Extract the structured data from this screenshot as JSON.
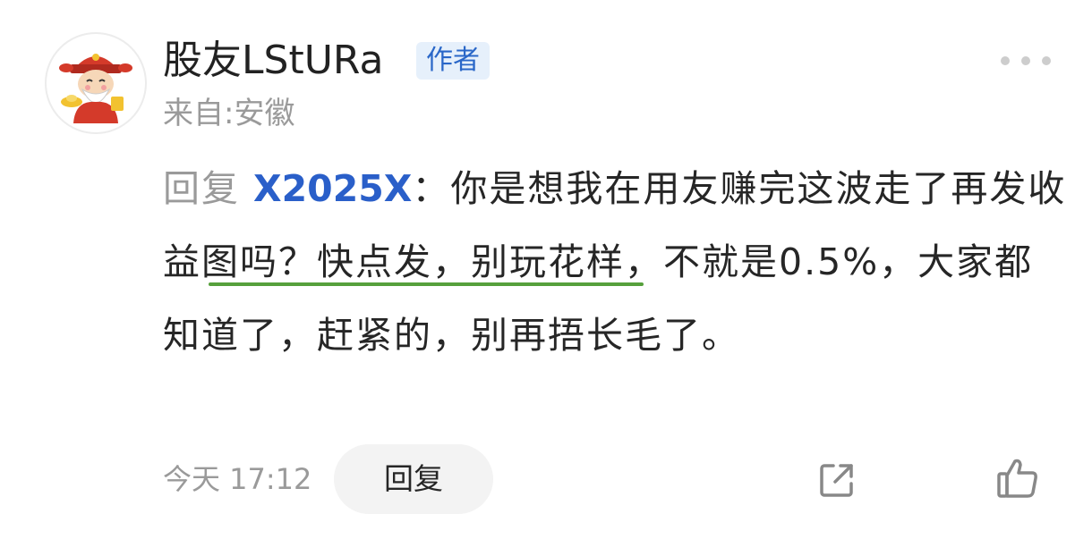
{
  "user": {
    "name": "股友LStURa",
    "badge": "作者",
    "location": "来自:安徽",
    "avatar_icon": "god-of-wealth-avatar"
  },
  "comment": {
    "reply_prefix": "回复",
    "mention": "X2025X",
    "separator": "：",
    "text": "你是想我在用友赚完这波走了再发收益图吗？快点发，别玩花样，不就是0.5%，大家都知道了，赶紧的，别再捂长毛了。"
  },
  "footer": {
    "timestamp": "今天 17:12",
    "reply_label": "回复",
    "share_icon": "share-icon",
    "like_icon": "thumbs-up-icon"
  },
  "colors": {
    "mention": "#2a5fc9",
    "badge_text": "#2a67c8",
    "badge_bg": "#e6f0fb",
    "underline": "#56a03c",
    "secondary_text": "#9a9a9a"
  }
}
